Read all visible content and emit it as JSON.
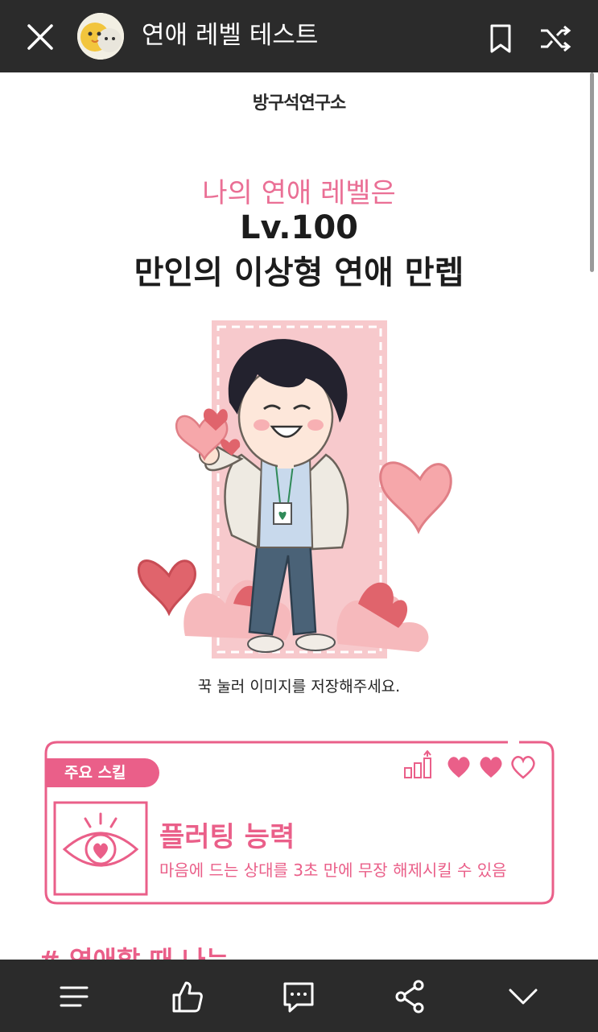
{
  "header": {
    "title": "연애 레벨 테스트",
    "icons": [
      "close-icon",
      "app-avatar",
      "bookmark-icon",
      "shuffle-icon"
    ]
  },
  "result": {
    "brand": "방구석연구소",
    "subhead": "나의 연애 레벨은",
    "level": "Lv.100",
    "level_name": "만인의 이상형 연애 만렙",
    "caption": "꾹 눌러 이미지를 저장해주세요."
  },
  "skill": {
    "badge": "주요 스킬",
    "title": "플러팅 능력",
    "description": "마음에 드는 상대를 3초 만에 무장 해제시킬 수 있음",
    "hearts_filled": 2,
    "hearts_total": 3
  },
  "section": {
    "header": "# 연애할 때 나는"
  },
  "bottom_nav": {
    "icons": [
      "menu-icon",
      "like-icon",
      "comment-icon",
      "share-icon",
      "chevron-down-icon"
    ]
  },
  "colors": {
    "accent": "#ea5f89",
    "bar": "#2b2b2b"
  }
}
